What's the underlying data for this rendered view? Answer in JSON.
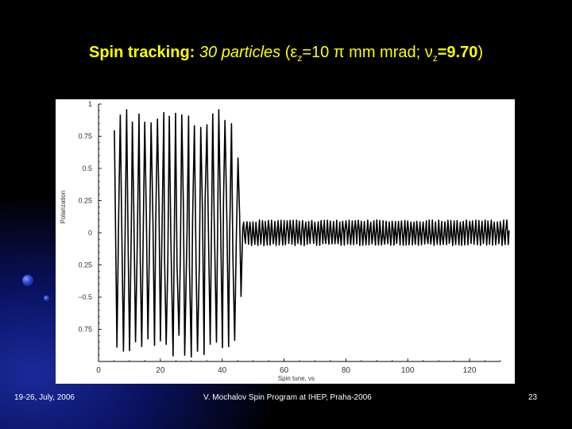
{
  "slide": {
    "title_strong": "Spin tracking:",
    "title_particles": "30 particles",
    "title_paren_open": " (",
    "title_eps": "ε",
    "title_eps_sub": "z",
    "title_emittance": "=10 π mm mrad; ",
    "title_nu": "ν",
    "title_nu_sub": "z",
    "title_tune": "=9.70",
    "title_paren_close": ")"
  },
  "footer": {
    "date": "19-26, July, 2006",
    "center": "V. Mochalov Spin Program at IHEP, Praha-2006",
    "page": "23"
  },
  "colors": {
    "title": "#ffff00",
    "background": "#000000",
    "plot_background": "#ffffff",
    "trace": "#000000"
  },
  "chart_data": {
    "type": "line",
    "xlabel": "Spin tune, νs",
    "ylabel": "Polarization",
    "xlim": [
      0,
      130
    ],
    "ylim": [
      -1,
      1
    ],
    "x_ticks": [
      "0",
      "20",
      "40",
      "60",
      "80",
      "100",
      "120"
    ],
    "y_ticks": [
      "1",
      "0.75",
      "0.5",
      "0.25",
      "0",
      "0.25",
      "−0.5",
      "0.75"
    ],
    "y_tick_values": [
      1,
      0.75,
      0.5,
      0.25,
      0,
      -0.25,
      -0.5,
      -0.75
    ],
    "grid": false,
    "series": [
      {
        "segments": [
          {
            "x_range": [
              5,
              45
            ],
            "amplitude": 0.97,
            "oscillations_per_unit": 0.5
          },
          {
            "x_range": [
              45,
              47
            ],
            "amplitude": 0.6,
            "oscillations_per_unit": 0.5
          },
          {
            "x_range": [
              47,
              133
            ],
            "amplitude": 0.1,
            "oscillations_per_unit": 1.0
          }
        ]
      }
    ]
  }
}
